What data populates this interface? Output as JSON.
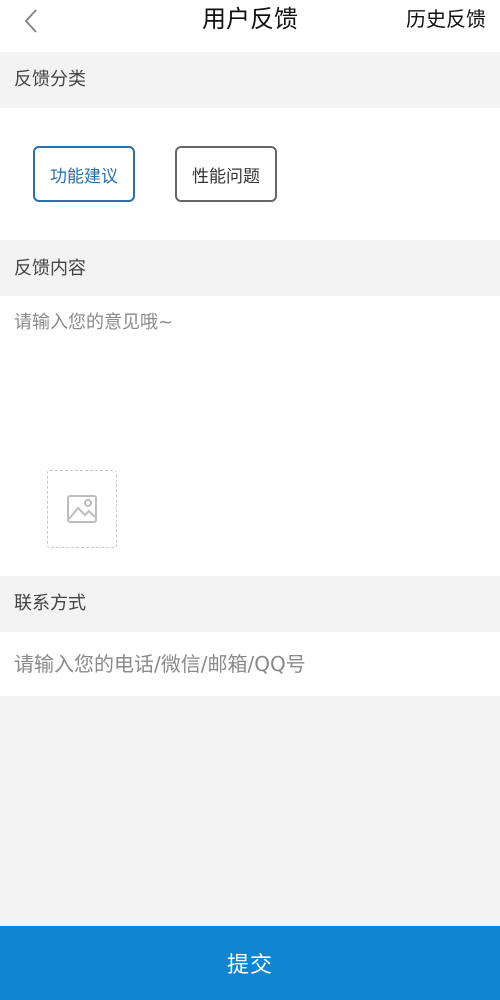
{
  "nav": {
    "back_icon": "chevron-left-icon",
    "title": "用户反馈",
    "history_label": "历史反馈"
  },
  "category": {
    "header": "反馈分类",
    "options": [
      {
        "label": "功能建议",
        "selected": true
      },
      {
        "label": "性能问题",
        "selected": false
      }
    ]
  },
  "content": {
    "header": "反馈内容",
    "placeholder": "请输入您的意见哦~",
    "value": "",
    "upload_icon": "image-icon"
  },
  "contact": {
    "header": "联系方式",
    "placeholder": "请输入您的电话/微信/邮箱/QQ号",
    "value": ""
  },
  "submit": {
    "label": "提交"
  },
  "colors": {
    "accent": "#0f86cf",
    "selected_border": "#2f6fa8",
    "selected_text": "#2c6ea5",
    "page_bg": "#f3f3f3"
  }
}
